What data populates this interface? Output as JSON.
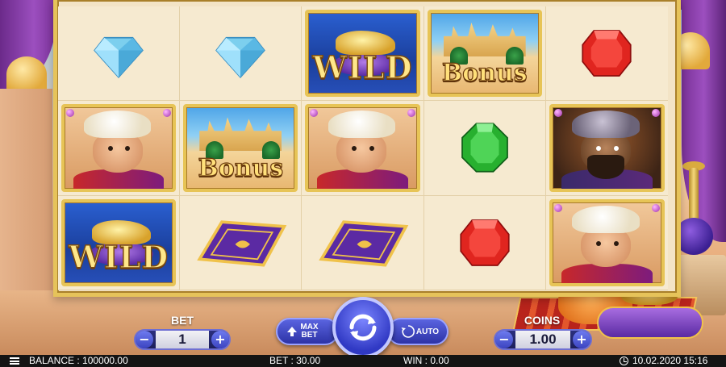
{
  "reels": {
    "rows": [
      [
        "diamond-blue",
        "diamond-blue",
        "wild",
        "bonus",
        "ruby-red"
      ],
      [
        "hero",
        "bonus",
        "hero",
        "emerald-green",
        "villain"
      ],
      [
        "wild",
        "magic-carpet",
        "magic-carpet",
        "ruby-red",
        "hero"
      ]
    ],
    "wild_label": "WILD",
    "bonus_label": "Bonus"
  },
  "controls": {
    "bet_label": "BET",
    "bet_value": "1",
    "coins_label": "COINS",
    "coins_value": "1.00",
    "minus_symbol": "−",
    "plus_symbol": "+",
    "max_bet_label_line1": "MAX",
    "max_bet_label_line2": "BET",
    "auto_label": "AUTO"
  },
  "status": {
    "balance": "BALANCE : 100000.00",
    "bet": "BET : 30.00",
    "win": "WIN : 0.00",
    "datetime": "10.02.2020 15:16"
  },
  "colors": {
    "frame_gold": "#e6c35a",
    "button_blue": "#3b44c0",
    "statusbar": "#141414",
    "ruby": "#e0251f",
    "emerald": "#27b02f",
    "diamond": "#7ccfee",
    "carpet": "#5b2aa3"
  },
  "icons": {
    "spin": "refresh-arrows-icon",
    "max_bet": "arrow-up-icon",
    "auto": "auto-rotate-icon",
    "menu": "hamburger-menu-icon",
    "clock": "clock-icon"
  }
}
